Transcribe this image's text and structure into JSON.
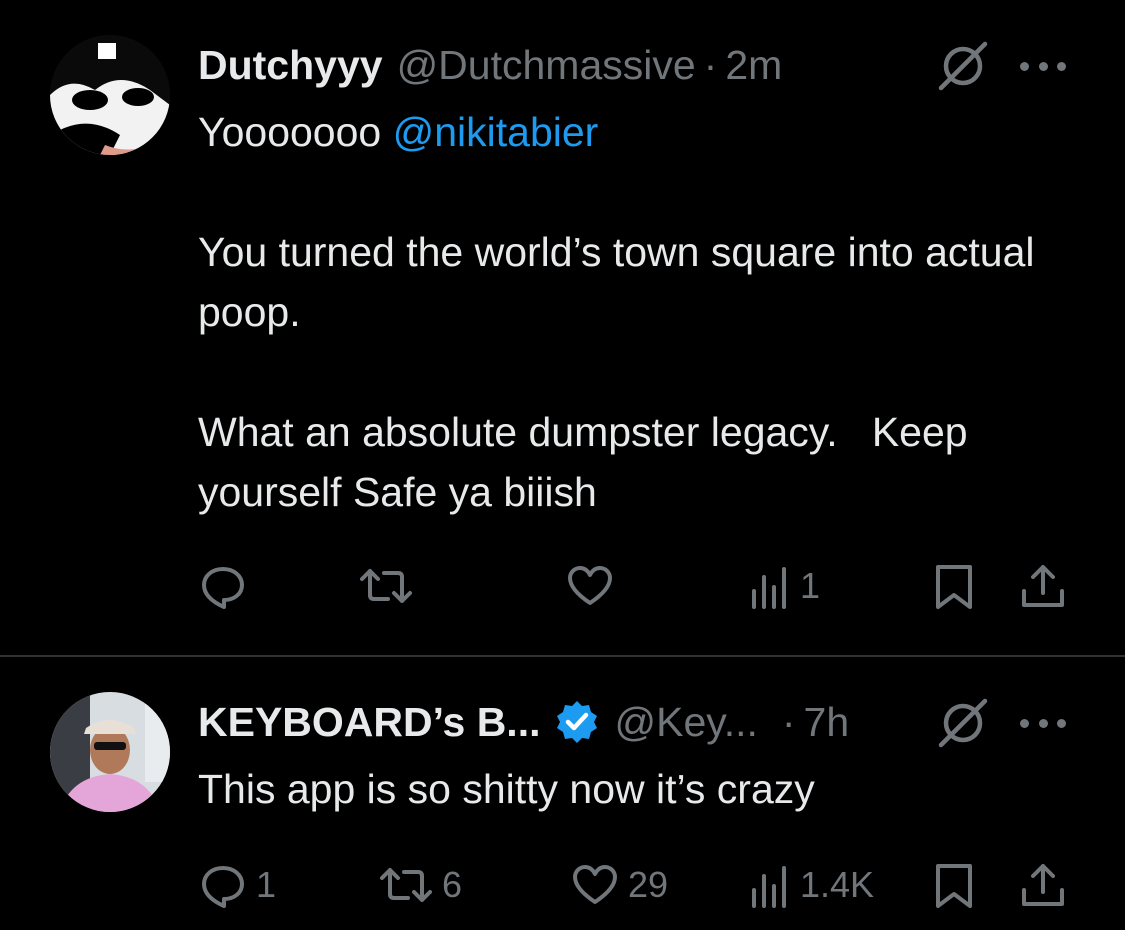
{
  "tweets": [
    {
      "display_name": "Dutchyyy",
      "handle": "@Dutchmassive",
      "separator": "·",
      "time": "2m",
      "verified": false,
      "mention": "@nikitabier",
      "paragraphs": [
        "Yooooooo",
        "You turned the world’s town square into actual poop.",
        "What an absolute dumpster legacy.   Keep yourself Safe ya biiish"
      ],
      "reply_count": "",
      "repost_count": "",
      "like_count": "",
      "view_count": "1"
    },
    {
      "display_name": "KEYBOARD’s B...",
      "handle": "@Key...",
      "separator": "·",
      "time": "7h",
      "verified": true,
      "text": "This app is so shitty now it’s crazy",
      "reply_count": "1",
      "repost_count": "6",
      "like_count": "29",
      "view_count": "1.4K"
    }
  ],
  "colors": {
    "background": "#000000",
    "text": "#e7e9ea",
    "muted": "#71767b",
    "accent": "#1d9bf0",
    "divider": "#2f3336"
  },
  "icons": [
    "reply-icon",
    "repost-icon",
    "like-icon",
    "views-icon",
    "bookmark-icon",
    "share-icon",
    "grok-icon",
    "more-icon",
    "verified-icon"
  ]
}
